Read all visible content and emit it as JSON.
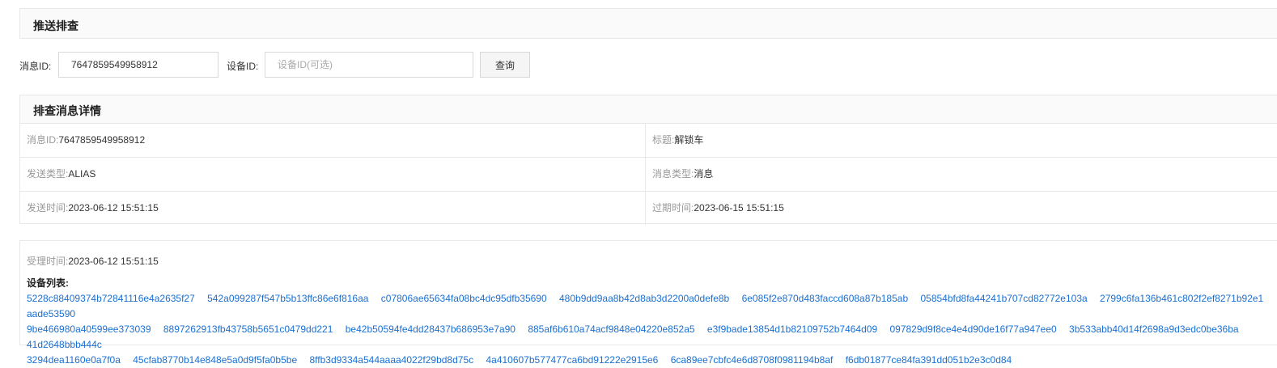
{
  "header": {
    "title": "推送排查"
  },
  "search": {
    "message_id_label": "消息ID:",
    "message_id_value": "7647859549958912",
    "device_id_label": "设备ID:",
    "device_id_placeholder": "设备ID(可选)",
    "query_button": "查询"
  },
  "detail": {
    "title": "排查消息详情",
    "rows": [
      {
        "left_key": "消息ID:",
        "left_value": "7647859549958912",
        "right_key": "标题:",
        "right_value": "解锁车"
      },
      {
        "left_key": "发送类型:",
        "left_value": "ALIAS",
        "right_key": "消息类型:",
        "right_value": "消息"
      },
      {
        "left_key": "发送时间:",
        "left_value": "2023-06-12 15:51:15",
        "right_key": "过期时间:",
        "right_value": "2023-06-15 15:51:15"
      }
    ]
  },
  "accept": {
    "time_key": "受理时间:",
    "time_value": "2023-06-12 15:51:15",
    "device_list_label": "设备列表:",
    "devices": [
      "5228c88409374b72841116e4a2635f27",
      "542a099287f547b5b13ffc86e6f816aa",
      "c07806ae65634fa08bc4dc95dfb35690",
      "480b9dd9aa8b42d8ab3d2200a0defe8b",
      "6e085f2e870d483faccd608a87b185ab",
      "05854bfd8fa44241b707cd82772e103a",
      "2799c6fa136b461c802f2ef8271b92e1",
      "aade53590",
      "9be466980a40599ee373039",
      "8897262913fb43758b5651c0479dd221",
      "be42b50594fe4dd28437b686953e7a90",
      "885af6b610a74acf9848e04220e852a5",
      "e3f9bade13854d1b82109752b7464d09",
      "097829d9f8ce4e4d90de16f77a947ee0",
      "3b533abb40d14f2698a9d3edc0be36ba",
      "41d2648bbb444c",
      "3294dea1160e0a7f0a",
      "45cfab8770b14e848e5a0d9f5fa0b5be",
      "8ffb3d9334a544aaaa4022f29bd8d75c",
      "4a410607b577477ca6bd91222e2915e6",
      "6ca89ee7cbfc4e6d8708f0981194b8af",
      "f6db01877ce84fa391dd051b2e3c0d84"
    ]
  }
}
